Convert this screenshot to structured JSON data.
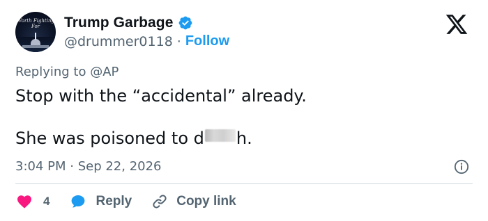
{
  "author": {
    "avatar_text": "Worth Fighting For",
    "display_name": "Trump Garbage",
    "verified_icon": "verified-badge-icon",
    "handle": "@drummer0118",
    "separator": "·",
    "follow_label": "Follow"
  },
  "brand": {
    "icon": "x-logo-icon"
  },
  "tweet": {
    "replying_to_prefix": "Replying to",
    "replying_to_handle": "@AP",
    "line1": "Stop with the “accidental” already.",
    "line2_before": "She was poisoned to d",
    "line2_after": "h.",
    "timestamp": "3:04 PM · Sep 22, 2026"
  },
  "actions": {
    "like_count": "4",
    "reply_label": "Reply",
    "copy_label": "Copy link"
  },
  "colors": {
    "accent": "#1d9bf0",
    "like": "#f91880",
    "text": "#0f1419",
    "muted": "#536471",
    "divider": "#cfd9de"
  }
}
